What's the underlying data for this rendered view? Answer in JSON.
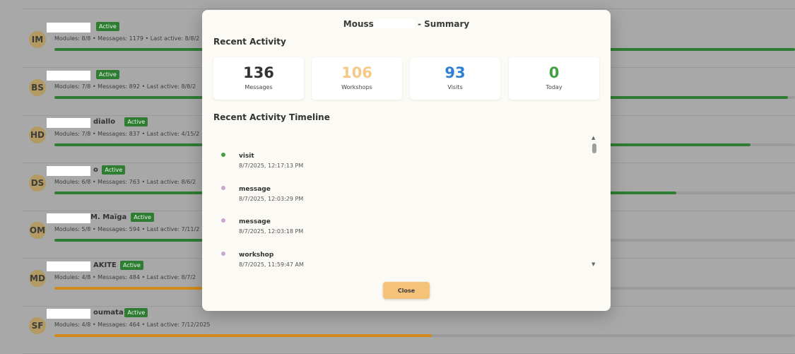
{
  "background_list": {
    "rows": [
      {
        "initials": "IM",
        "name_suffix": "",
        "status": "Active",
        "meta": "Modules: 8/8 • Messages: 1179 • Last active: 8/8/2",
        "progress_pct": 100,
        "color": "#2e7d32"
      },
      {
        "initials": "BS",
        "name_suffix": "",
        "status": "Active",
        "meta": "Modules: 7/8 • Messages: 892 • Last active: 8/8/2",
        "progress_pct": 99,
        "color": "#2e7d32"
      },
      {
        "initials": "HD",
        "name_suffix": "diallo",
        "status": "Active",
        "meta": "Modules: 7/8 • Messages: 837 • Last active: 4/15/2",
        "progress_pct": 94,
        "color": "#2e7d32"
      },
      {
        "initials": "DS",
        "name_suffix": "o",
        "status": "Active",
        "meta": "Modules: 6/8 • Messages: 763 • Last active: 8/6/2",
        "progress_pct": 84,
        "color": "#2e7d32"
      },
      {
        "initials": "OM",
        "name_suffix": "M. Maïga",
        "status": "Active",
        "meta": "Modules: 5/8 • Messages: 594 • Last active: 7/11/2",
        "progress_pct": 40,
        "color": "#2e7d32"
      },
      {
        "initials": "MD",
        "name_suffix": "AKITE",
        "status": "Active",
        "meta": "Modules: 4/8 • Messages: 484 • Last active: 8/7/2",
        "progress_pct": 30,
        "color": "#d18a1a"
      },
      {
        "initials": "SF",
        "name_suffix": "oumata",
        "status": "Active",
        "meta": "Modules: 4/8 • Messages: 464 • Last active: 7/12/2025",
        "progress_pct": 51,
        "color": "#d18a1a"
      }
    ]
  },
  "modal": {
    "title_prefix": "Mouss",
    "title_suffix": "- Summary",
    "recent_activity_heading": "Recent Activity",
    "stats": [
      {
        "value": "136",
        "label": "Messages",
        "color": "#333333"
      },
      {
        "value": "106",
        "label": "Workshops",
        "color": "#f5c987"
      },
      {
        "value": "93",
        "label": "Visits",
        "color": "#2f80d1"
      },
      {
        "value": "0",
        "label": "Today",
        "color": "#43a047"
      }
    ],
    "timeline_heading": "Recent Activity Timeline",
    "timeline": [
      {
        "type": "visit",
        "time": "8/7/2025, 12:17:13 PM",
        "dot_color": "#43a047"
      },
      {
        "type": "message",
        "time": "8/7/2025, 12:03:29 PM",
        "dot_color": "#c6a8d4"
      },
      {
        "type": "message",
        "time": "8/7/2025, 12:03:18 PM",
        "dot_color": "#c6a8d4"
      },
      {
        "type": "workshop",
        "time": "8/7/2025, 11:59:47 AM",
        "dot_color": "#c6a8d4"
      }
    ],
    "close_label": "Close"
  }
}
